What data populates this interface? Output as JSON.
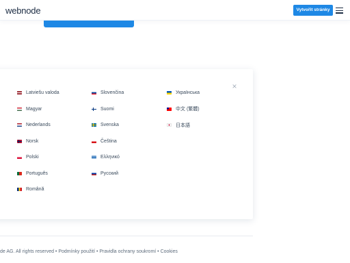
{
  "header": {
    "logo": "webnode",
    "cta_label": "Vytvořit stránky"
  },
  "languages": {
    "columns": [
      [
        {
          "label": "Latviešu valoda",
          "flag": "lv"
        },
        {
          "label": "Magyar",
          "flag": "hu"
        },
        {
          "label": "Nederlands",
          "flag": "nl"
        },
        {
          "label": "Norsk",
          "flag": "no"
        },
        {
          "label": "Polski",
          "flag": "pl"
        },
        {
          "label": "Português",
          "flag": "pt"
        },
        {
          "label": "Română",
          "flag": "ro"
        }
      ],
      [
        {
          "label": "Slovenčina",
          "flag": "sk"
        },
        {
          "label": "Suomi",
          "flag": "fi"
        },
        {
          "label": "Svenska",
          "flag": "se"
        },
        {
          "label": "Čeština",
          "flag": "cz"
        },
        {
          "label": "Ελληνικό",
          "flag": "gr"
        },
        {
          "label": "Русский",
          "flag": "ru"
        }
      ],
      [
        {
          "label": "Українська",
          "flag": "ua"
        },
        {
          "label": "中文 (繁體)",
          "flag": "tw"
        },
        {
          "label": "日本語",
          "flag": "jp"
        }
      ]
    ]
  },
  "footer": {
    "text": "de AG. All rights reserved • Podmínky použití • Pravidla ochrany soukromí • Cookies"
  },
  "colors": {
    "accent": "#1e88e5",
    "text": "#3a4a5c"
  }
}
